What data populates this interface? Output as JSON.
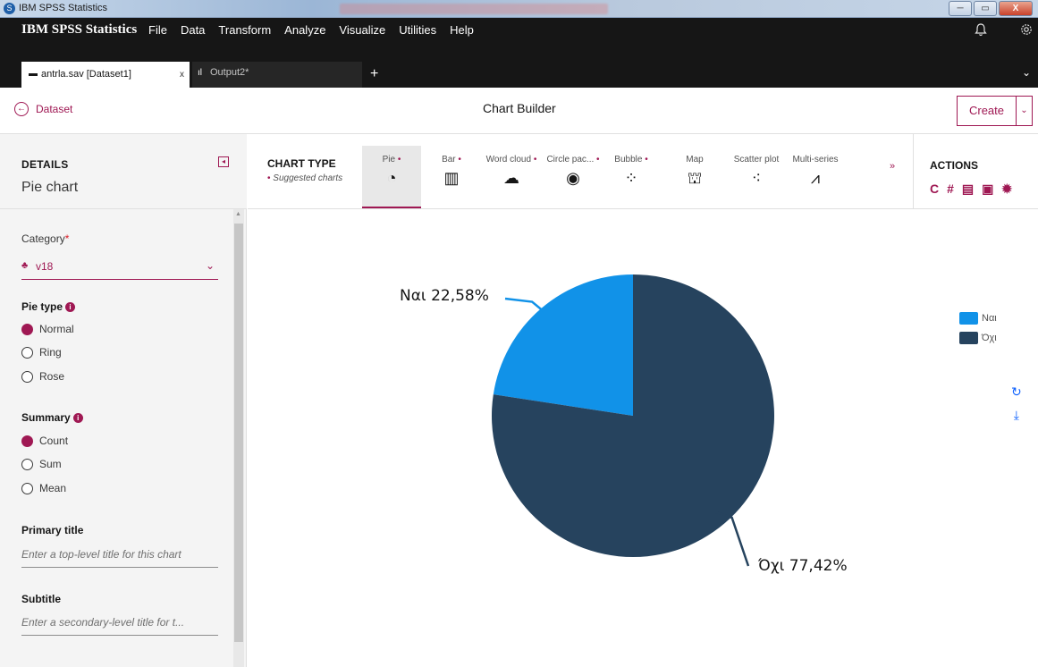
{
  "window": {
    "title": "IBM SPSS Statistics",
    "controls": {
      "minimize": "─",
      "maximize": "▭",
      "close": "X"
    }
  },
  "menubar": {
    "brand": "IBM SPSS Statistics",
    "items": [
      "File",
      "Data",
      "Transform",
      "Analyze",
      "Visualize",
      "Utilities",
      "Help"
    ]
  },
  "tabs": {
    "active": {
      "label": "antrla.sav [Dataset1]",
      "close": "x"
    },
    "other": {
      "label": "Output2*"
    },
    "add": "+"
  },
  "header": {
    "back_label": "Dataset",
    "title": "Chart Builder",
    "create_label": "Create"
  },
  "details": {
    "label": "DETAILS",
    "value": "Pie chart",
    "category": {
      "label": "Category",
      "required": "*",
      "value": "v18"
    },
    "pie_type": {
      "label": "Pie type",
      "options": [
        "Normal",
        "Ring",
        "Rose"
      ],
      "selected": 0
    },
    "summary": {
      "label": "Summary",
      "options": [
        "Count",
        "Sum",
        "Mean"
      ],
      "selected": 0
    },
    "primary_title": {
      "label": "Primary title",
      "placeholder": "Enter a top-level title for this chart"
    },
    "subtitle": {
      "label": "Subtitle",
      "placeholder": "Enter a secondary-level title for t..."
    }
  },
  "chart_type": {
    "label": "CHART TYPE",
    "suggested": "Suggested charts",
    "items": [
      {
        "name": "Pie",
        "suggested": true,
        "icon": "pie-icon",
        "glyph": "◔"
      },
      {
        "name": "Bar",
        "suggested": true,
        "icon": "bar-icon",
        "glyph": "▥"
      },
      {
        "name": "Word cloud",
        "suggested": true,
        "icon": "word-cloud-icon",
        "glyph": "☁"
      },
      {
        "name": "Circle pac...",
        "suggested": true,
        "icon": "circle-packing-icon",
        "glyph": "◉"
      },
      {
        "name": "Bubble",
        "suggested": true,
        "icon": "bubble-icon",
        "glyph": "⁘"
      },
      {
        "name": "Map",
        "suggested": false,
        "icon": "map-icon",
        "glyph": "⛫"
      },
      {
        "name": "Scatter plot",
        "suggested": false,
        "icon": "scatter-plot-icon",
        "glyph": "⁖"
      },
      {
        "name": "Multi-series",
        "suggested": false,
        "icon": "multi-series-icon",
        "glyph": "⩘"
      }
    ]
  },
  "actions": {
    "label": "ACTIONS",
    "icons": [
      "refresh-icon",
      "hashtag-icon",
      "export-csv-icon",
      "export-image-icon",
      "settings-icon"
    ]
  },
  "colors": {
    "accent": "#9f1853",
    "nai": "#1192e8",
    "oxi": "#26435e"
  },
  "chart_data": {
    "type": "pie",
    "categories": [
      "Ναι",
      "Όχι"
    ],
    "values": [
      22.58,
      77.42
    ],
    "data_labels": [
      "Ναι 22,58%",
      "Όχι 77,42%"
    ],
    "colors": [
      "#1192e8",
      "#26435e"
    ],
    "legend": {
      "position": "right",
      "entries": [
        "Ναι",
        "Όχι"
      ]
    }
  }
}
